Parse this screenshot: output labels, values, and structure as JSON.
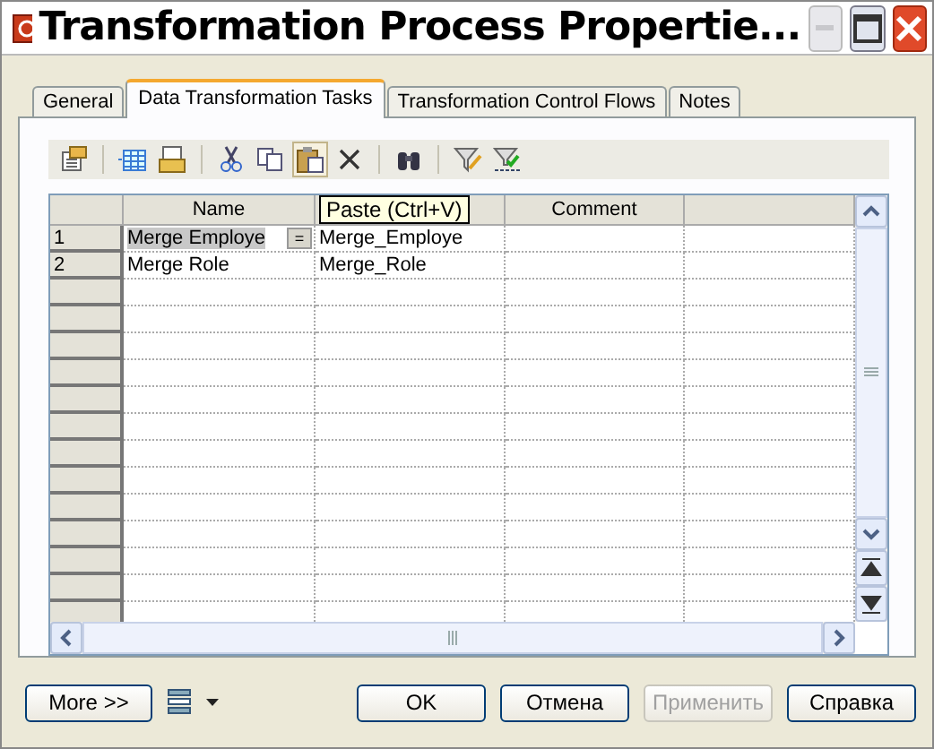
{
  "window": {
    "title": "Transformation Process Propertie..."
  },
  "tabs": [
    {
      "label": "General",
      "selected": false
    },
    {
      "label": "Data Transformation Tasks",
      "selected": true
    },
    {
      "label": "Transformation Control Flows",
      "selected": false
    },
    {
      "label": "Notes",
      "selected": false
    }
  ],
  "toolbar": {
    "buttons": [
      {
        "hovered": false
      },
      {
        "hovered": false
      },
      {
        "hovered": false
      },
      {
        "hovered": false
      },
      {
        "hovered": false
      },
      {
        "hovered": true
      },
      {
        "hovered": false
      },
      {
        "hovered": false
      },
      {
        "hovered": false
      },
      {
        "hovered": false
      }
    ]
  },
  "tooltip": {
    "text": "Paste (Ctrl+V)"
  },
  "table": {
    "columns": [
      "Name",
      null,
      "Comment",
      null
    ],
    "rows": [
      {
        "number": "1",
        "cells": [
          "Merge Employe",
          "Merge_Employe"
        ],
        "editing": true,
        "edit_button": "="
      },
      {
        "number": "2",
        "cells": [
          "Merge Role",
          "Merge_Role"
        ],
        "editing": false
      }
    ]
  },
  "buttons": [
    {
      "label": "More >>",
      "disabled": false
    },
    {
      "label": "OK",
      "disabled": false
    },
    {
      "label": "Отмена",
      "disabled": false
    },
    {
      "label": "Применить",
      "disabled": true
    },
    {
      "label": "Справка",
      "disabled": false
    }
  ]
}
